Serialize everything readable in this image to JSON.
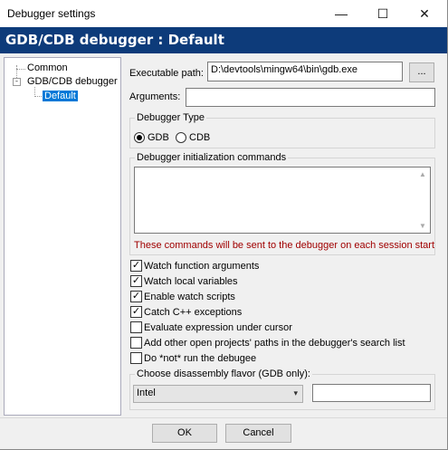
{
  "window": {
    "title": "Debugger settings",
    "minimize": "—",
    "maximize": "☐",
    "close": "✕"
  },
  "header": {
    "title": "GDB/CDB debugger : Default"
  },
  "tree": {
    "items": [
      {
        "label": "Common"
      },
      {
        "label": "GDB/CDB debugger",
        "expander": "-"
      },
      {
        "label": "Default",
        "selected": true
      }
    ]
  },
  "form": {
    "executable_label": "Executable path:",
    "executable_value": "D:\\devtools\\mingw64\\bin\\gdb.exe",
    "browse_label": "...",
    "arguments_label": "Arguments:",
    "arguments_value": "",
    "debugger_type": {
      "title": "Debugger Type",
      "options": [
        {
          "label": "GDB",
          "checked": true
        },
        {
          "label": "CDB",
          "checked": false
        }
      ]
    },
    "init_commands": {
      "title": "Debugger initialization commands",
      "value": "",
      "note": "These commands will be sent to the debugger on each session start"
    },
    "checkboxes": [
      {
        "label": "Watch function arguments",
        "checked": true
      },
      {
        "label": "Watch local variables",
        "checked": true
      },
      {
        "label": "Enable watch scripts",
        "checked": true
      },
      {
        "label": "Catch C++ exceptions",
        "checked": true
      },
      {
        "label": "Evaluate expression under cursor",
        "checked": false
      },
      {
        "label": "Add other open projects' paths in the debugger's search list",
        "checked": false
      },
      {
        "label": "Do *not* run the debugee",
        "checked": false
      }
    ],
    "disassembly": {
      "title": "Choose disassembly flavor (GDB only):",
      "selected": "Intel",
      "extra_value": ""
    }
  },
  "footer": {
    "ok_label": "OK",
    "cancel_label": "Cancel"
  },
  "icons": {
    "check": "✓",
    "caret": "▾"
  }
}
